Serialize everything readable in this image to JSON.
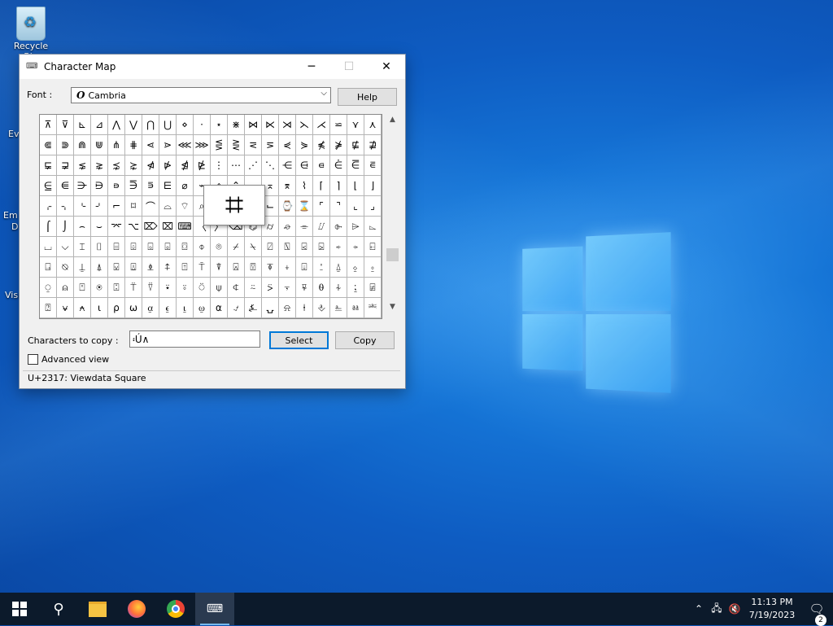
{
  "desktop": {
    "icons": [
      {
        "label": "Recycle Bin"
      },
      {
        "label": "Ev"
      },
      {
        "label": "Em"
      },
      {
        "label": "D"
      },
      {
        "label": "Visu"
      }
    ]
  },
  "window": {
    "title": "Character Map",
    "font_label": "Font :",
    "font_value": "Cambria",
    "font_icon_glyph": "O",
    "help_label": "Help",
    "characters": [
      "⊼",
      "⊽",
      "⊾",
      "⊿",
      "⋀",
      "⋁",
      "⋂",
      "⋃",
      "⋄",
      "⋅",
      "⋆",
      "⋇",
      "⋈",
      "⋉",
      "⋊",
      "⋋",
      "⋌",
      "⋍",
      "⋎",
      "⋏",
      "⋐",
      "⋑",
      "⋒",
      "⋓",
      "⋔",
      "⋕",
      "⋖",
      "⋗",
      "⋘",
      "⋙",
      "⋚",
      "⋛",
      "⋜",
      "⋝",
      "⋞",
      "⋟",
      "⋠",
      "⋡",
      "⋢",
      "⋣",
      "⋤",
      "⋥",
      "⋦",
      "⋧",
      "⋨",
      "⋩",
      "⋪",
      "⋫",
      "⋬",
      "⋭",
      "⋮",
      "⋯",
      "⋰",
      "⋱",
      "⋲",
      "⋳",
      "⋴",
      "⋵",
      "⋶",
      "⋷",
      "⋸",
      "⋹",
      "⋺",
      "⋻",
      "⋼",
      "⋽",
      "⋾",
      "⋿",
      "⌀",
      "⌁",
      "⌂",
      "⌃",
      "⌄",
      "⌅",
      "⌆",
      "⌇",
      "⌈",
      "⌉",
      "⌊",
      "⌋",
      "⌌",
      "⌍",
      "⌎",
      "⌏",
      "⌐",
      "⌑",
      "⌒",
      "⌓",
      "⌔",
      "⌕",
      "⌖",
      "⌗",
      "⌘",
      "⌙",
      "⌚",
      "⌛",
      "⌜",
      "⌝",
      "⌞",
      "⌟",
      "⌠",
      "⌡",
      "⌢",
      "⌣",
      "⌤",
      "⌥",
      "⌦",
      "⌧",
      "⌨",
      "〈",
      "〉",
      "⌫",
      "⌬",
      "⌭",
      "⌮",
      "⌯",
      "⌰",
      "⌱",
      "⌲",
      "⌳",
      "⌴",
      "⌵",
      "⌶",
      "⌷",
      "⌸",
      "⌹",
      "⌺",
      "⌻",
      "⌼",
      "⌽",
      "⌾",
      "⌿",
      "⍀",
      "⍁",
      "⍂",
      "⍃",
      "⍄",
      "⍅",
      "⍆",
      "⍇",
      "⍈",
      "⍉",
      "⍊",
      "⍋",
      "⍌",
      "⍍",
      "⍎",
      "⍏",
      "⍐",
      "⍑",
      "⍒",
      "⍓",
      "⍔",
      "⍕",
      "⍖",
      "⍗",
      "⍘",
      "⍙",
      "⍚",
      "⍛",
      "⍜",
      "⍝",
      "⍞",
      "⍟",
      "⍠",
      "⍡",
      "⍢",
      "⍣",
      "⍤",
      "⍥",
      "⍦",
      "⍧",
      "⍨",
      "⍩",
      "⍪",
      "⍫",
      "⍬",
      "⍭",
      "⍮",
      "⍯",
      "⍰",
      "⍱",
      "⍲",
      "⍳",
      "⍴",
      "⍵",
      "⍶",
      "⍷",
      "⍸",
      "⍹",
      "⍺",
      "⍻",
      "⍼",
      "⍽",
      "⍾",
      "⍿",
      "⎀",
      "⎁",
      "⎂",
      "⎃"
    ],
    "zoom_char": "⌗",
    "characters_to_copy_label": "Characters to copy :",
    "characters_to_copy_value": "፡Ú∧",
    "select_label": "Select",
    "copy_label": "Copy",
    "advanced_view_label": "Advanced view",
    "advanced_view_checked": false,
    "status_text": "U+2317: Viewdata Square"
  },
  "taskbar": {
    "clock_time": "11:13 PM",
    "clock_date": "7/19/2023",
    "notification_count": "2"
  },
  "colors": {
    "desktop_bg": "#1574d6",
    "taskbar_bg": "#0c1a2b",
    "accent": "#0078d7"
  }
}
